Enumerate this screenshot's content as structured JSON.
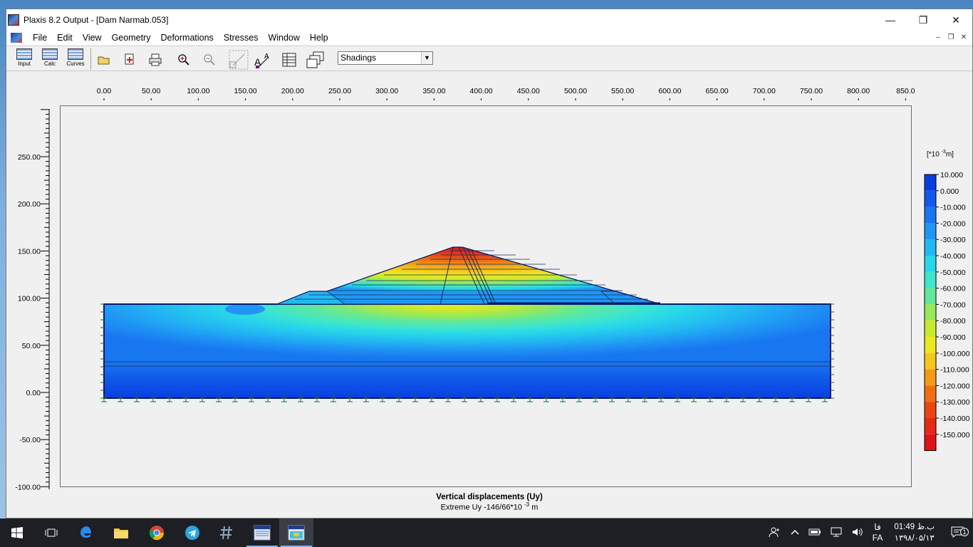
{
  "window": {
    "title": "Plaxis 8.2 Output - [Dam Narmab.053]",
    "controls": {
      "minimize": "—",
      "maximize": "❐",
      "close": "✕"
    }
  },
  "menu": [
    "File",
    "Edit",
    "View",
    "Geometry",
    "Deformations",
    "Stresses",
    "Window",
    "Help"
  ],
  "toolbar": {
    "programs": [
      "Input",
      "Calc",
      "Curves"
    ],
    "icons": [
      "open-icon",
      "export-icon",
      "print-icon",
      "zoom-in-icon",
      "zoom-out-icon",
      "select-icon",
      "text-size-icon",
      "table-icon",
      "copy-icon"
    ],
    "view_select": {
      "value": "Shadings"
    }
  },
  "rulers": {
    "x_labels": [
      "0.00",
      "50.00",
      "100.00",
      "150.00",
      "200.00",
      "250.00",
      "300.00",
      "350.00",
      "400.00",
      "450.00",
      "500.00",
      "550.00",
      "600.00",
      "650.00",
      "700.00",
      "750.00",
      "800.00",
      "850.0"
    ],
    "y_labels": [
      "250.00",
      "200.00",
      "150.00",
      "100.00",
      "50.00",
      "0.00",
      "-50.00",
      "-100.00"
    ]
  },
  "legend": {
    "unit_prefix": "[*10 ",
    "unit_exp": "-3",
    "unit_suffix": "m]",
    "entries": [
      {
        "label": "10.000",
        "color": "#0a3de0"
      },
      {
        "label": "0.000",
        "color": "#1059ea"
      },
      {
        "label": "-10.000",
        "color": "#1877f0"
      },
      {
        "label": "-20.000",
        "color": "#1f96f4"
      },
      {
        "label": "-30.000",
        "color": "#22b8f2"
      },
      {
        "label": "-40.000",
        "color": "#27d6ea"
      },
      {
        "label": "-50.000",
        "color": "#3ee6cc"
      },
      {
        "label": "-60.000",
        "color": "#62e898"
      },
      {
        "label": "-70.000",
        "color": "#97e85a"
      },
      {
        "label": "-80.000",
        "color": "#c8ea2e"
      },
      {
        "label": "-90.000",
        "color": "#ece820"
      },
      {
        "label": "-100.000",
        "color": "#f4c71c"
      },
      {
        "label": "-110.000",
        "color": "#f39a18"
      },
      {
        "label": "-120.000",
        "color": "#ee6e14"
      },
      {
        "label": "-130.000",
        "color": "#e84612"
      },
      {
        "label": "-140.000",
        "color": "#e52a14"
      },
      {
        "label": "-150.000",
        "color": "#e01418"
      }
    ]
  },
  "status": {
    "title": "Vertical displacements (Uy)",
    "extreme_prefix": "Extreme Uy -146/66*10 ",
    "extreme_exp": "-3",
    "extreme_suffix": " m"
  },
  "taskbar": {
    "apps": [
      "start-icon",
      "task-view-icon",
      "edge-icon",
      "file-explorer-icon",
      "chrome-icon",
      "telegram-icon",
      "app-hash-icon",
      "plaxis-input-icon",
      "plaxis-output-icon"
    ],
    "lang_top": "فا",
    "lang_bottom": "FA",
    "time": "01:49 ب.ظ",
    "date": "۱۳۹۸/۰۵/۱۳",
    "notification_count": "1"
  }
}
